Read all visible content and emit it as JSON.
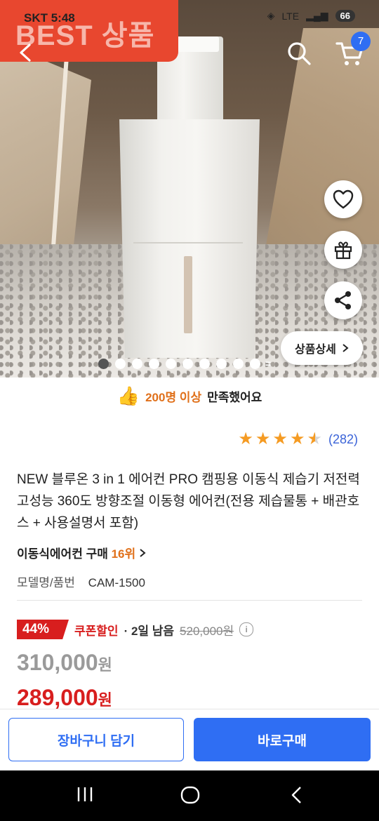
{
  "status_bar": {
    "carrier_time": "SKT 5:48",
    "network": "LTE",
    "battery": "66"
  },
  "hero": {
    "badge_text": "BEST 상품",
    "detail_label": "상품상세"
  },
  "header": {
    "cart_count": "7"
  },
  "satisfaction": {
    "highlight": "200명 이상",
    "rest": "만족했어요"
  },
  "rating": {
    "stars": 4.5,
    "count": "(282)"
  },
  "product": {
    "title": "NEW 블루온 3 in 1 에어컨 PRO 캠핑용 이동식 제습기 저전력 고성능 360도 방향조절 이동형 에어컨(전용 제습물통 + 배관호스 + 사용설명서 포함)",
    "rank_prefix": "이동식에어컨 구매",
    "rank_value": "16위",
    "model_label": "모델명/품번",
    "model_value": "CAM-1500"
  },
  "pricing": {
    "discount_pct": "44%",
    "coupon_label": "쿠폰할인",
    "remaining": "· 2일 남음",
    "original_price": "520,000원",
    "price_before": "310,000",
    "price_final": "289,000",
    "won": "원"
  },
  "actions": {
    "add_to_cart": "장바구니 담기",
    "buy_now": "바로구매"
  },
  "colors": {
    "accent": "#2f6ef3",
    "sale": "#d81e1e",
    "highlight": "#e0701a",
    "badge": "#e8472f"
  }
}
